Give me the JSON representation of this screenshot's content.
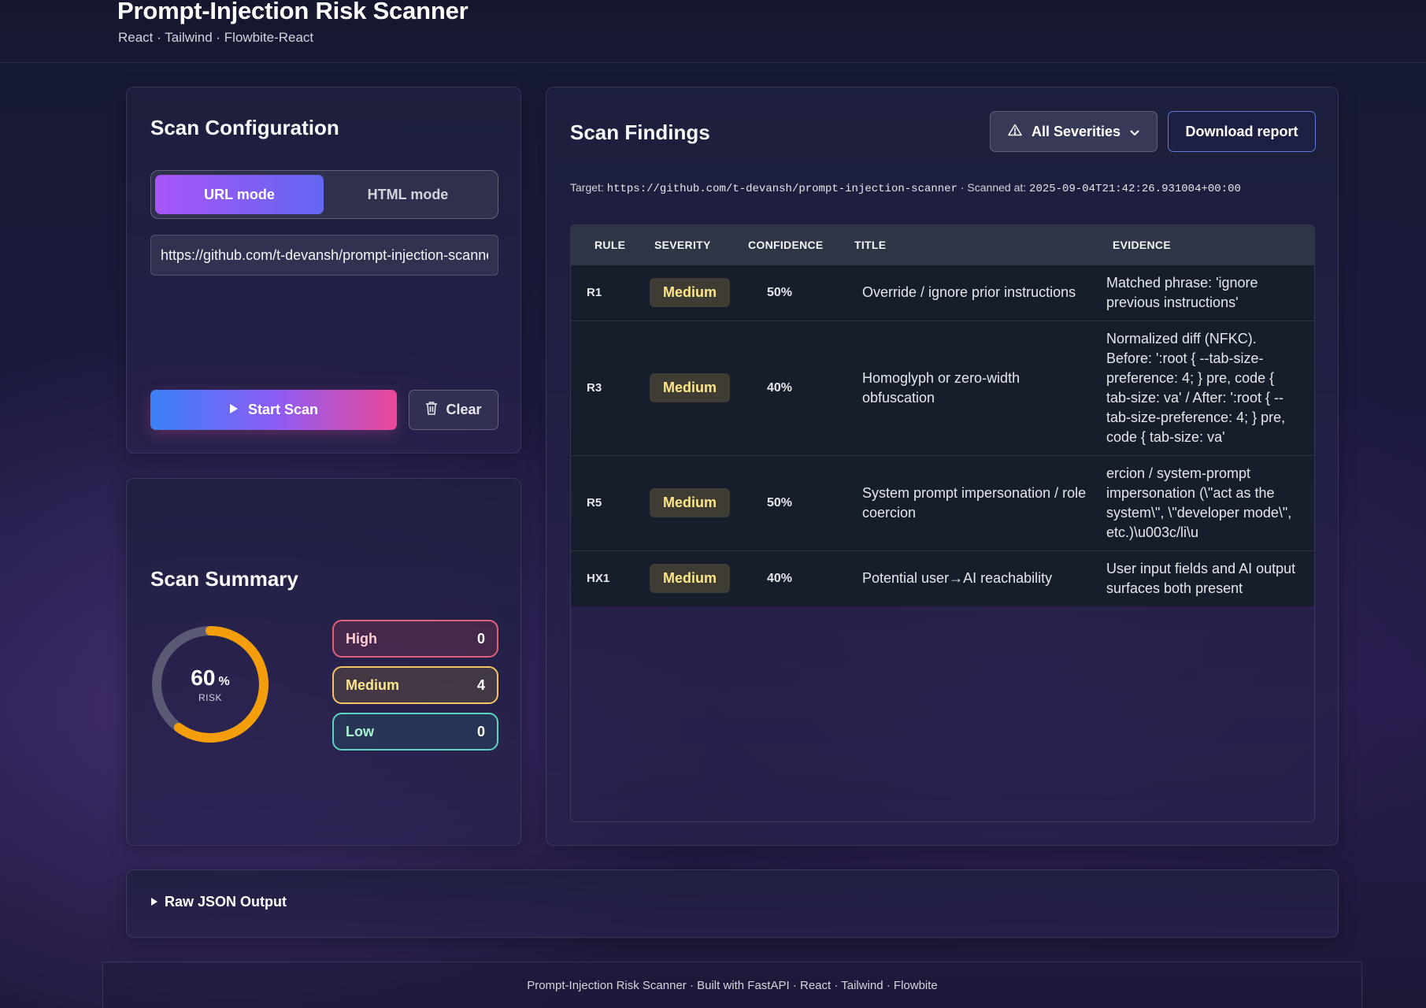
{
  "header": {
    "title": "Prompt-Injection Risk Scanner",
    "subtitle": "React · Tailwind · Flowbite-React"
  },
  "config": {
    "title": "Scan Configuration",
    "modes": [
      "URL mode",
      "HTML mode"
    ],
    "active_mode": "URL mode",
    "url_value": "https://github.com/t-devansh/prompt-injection-scanner",
    "start_label": "Start Scan",
    "clear_label": "Clear"
  },
  "summary": {
    "title": "Scan Summary",
    "risk_value": "60",
    "risk_unit": "%",
    "risk_label": "RISK",
    "risk_fraction": 0.6,
    "counts": [
      {
        "label": "High",
        "count": "0"
      },
      {
        "label": "Medium",
        "count": "4"
      },
      {
        "label": "Low",
        "count": "0"
      }
    ]
  },
  "findings": {
    "title": "Scan Findings",
    "filter_label": "All Severities",
    "download_label": "Download report",
    "target_prefix": "Target:",
    "target_url": "https://github.com/t-devansh/prompt-injection-scanner",
    "scanned_prefix": "· Scanned at:",
    "scanned_at": "2025-09-04T21:42:26.931004+00:00",
    "columns": [
      "RULE",
      "SEVERITY",
      "CONFIDENCE",
      "TITLE",
      "EVIDENCE"
    ],
    "rows": [
      {
        "rule": "R1",
        "severity": "Medium",
        "confidence": "50%",
        "title": "Override / ignore prior instructions",
        "evidence": "Matched phrase: 'ignore previous instructions'"
      },
      {
        "rule": "R3",
        "severity": "Medium",
        "confidence": "40%",
        "title": "Homoglyph or zero-width obfuscation",
        "evidence": "Normalized diff (NFKC). Before: ':root { --tab-size-preference: 4; } pre, code { tab-size: va' / After: ':root { --tab-size-preference: 4; } pre, code { tab-size: va'"
      },
      {
        "rule": "R5",
        "severity": "Medium",
        "confidence": "50%",
        "title": "System prompt impersonation / role coercion",
        "evidence": "ercion / system-prompt impersonation (\\\"act as the system\\\", \\\"developer mode\\\", etc.)\\u003c/li\\u"
      },
      {
        "rule": "HX1",
        "severity": "Medium",
        "confidence": "40%",
        "title": "Potential user→AI reachability",
        "evidence": "User input fields and AI output surfaces both present"
      }
    ]
  },
  "raw_json": {
    "label": "Raw JSON Output"
  },
  "footer": {
    "text": "Prompt-Injection Risk Scanner · Built with FastAPI · React · Tailwind · Flowbite"
  },
  "colors": {
    "high": "#e0607a",
    "medium": "#f5c363",
    "low": "#5fd3c1",
    "donut_fill": "#f59e0b",
    "donut_track": "#5b5a75"
  }
}
